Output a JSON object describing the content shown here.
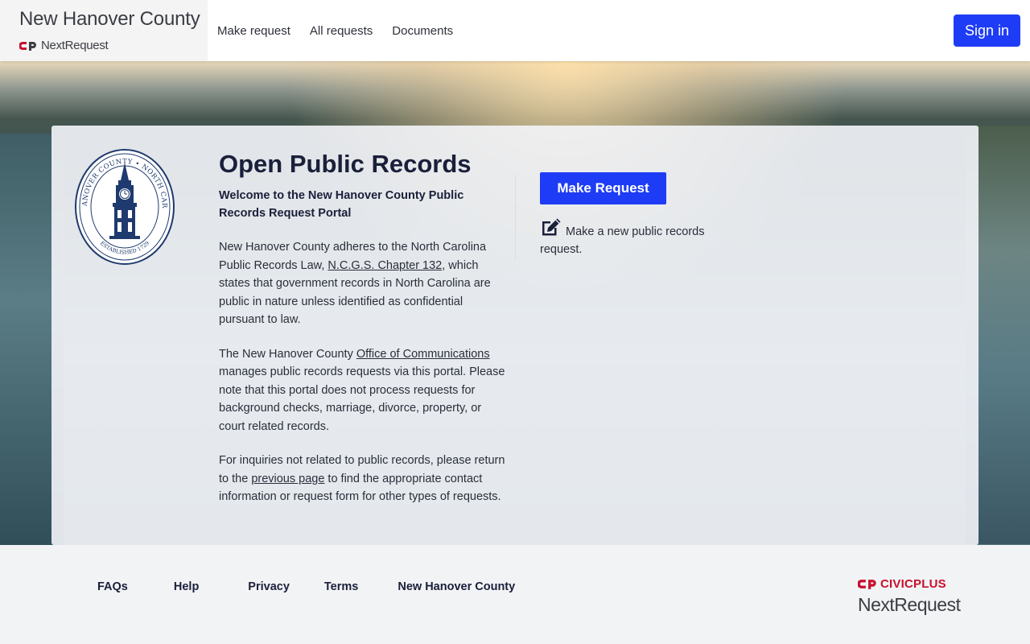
{
  "header": {
    "brand_title": "New Hanover County",
    "brand_sub": "NextRequest",
    "nav": [
      "Make request",
      "All requests",
      "Documents"
    ],
    "signin_label": "Sign in",
    "brand_color": "#1e3cf5"
  },
  "card": {
    "title": "Open Public Records",
    "welcome": "Welcome to the New Hanover County Public Records Request Portal",
    "p1_pre": "New Hanover County adheres to the North Carolina Public Records Law, ",
    "p1_link": "N.C.G.S. Chapter 132",
    "p1_post": ", which states that government records in North Carolina are public in nature unless identified as confidential pursuant to law.",
    "p2_pre": "The New Hanover County ",
    "p2_link": "Office of Communications",
    "p2_post": " manages public records requests via this portal. Please note that this portal does not process requests for background checks, marriage, divorce, property, or court related records.",
    "p3_pre": "For inquiries not related to public records, please return to the ",
    "p3_link": "previous page",
    "p3_post": " to find the appropriate contact information or request form for other types of requests.",
    "make_request_label": "Make Request",
    "make_request_desc": "Make a new public records request.",
    "seal": {
      "top_text": "NEW HANOVER COUNTY • NORTH CAROLINA",
      "bottom_text": "ESTABLISHED 1729"
    }
  },
  "footer": {
    "links": [
      "FAQs",
      "Help",
      "Privacy",
      "Terms",
      "New Hanover County"
    ],
    "civic_top": "CIVICPLUS",
    "civic_bottom": "NextRequest",
    "civic_color": "#c8102e"
  }
}
